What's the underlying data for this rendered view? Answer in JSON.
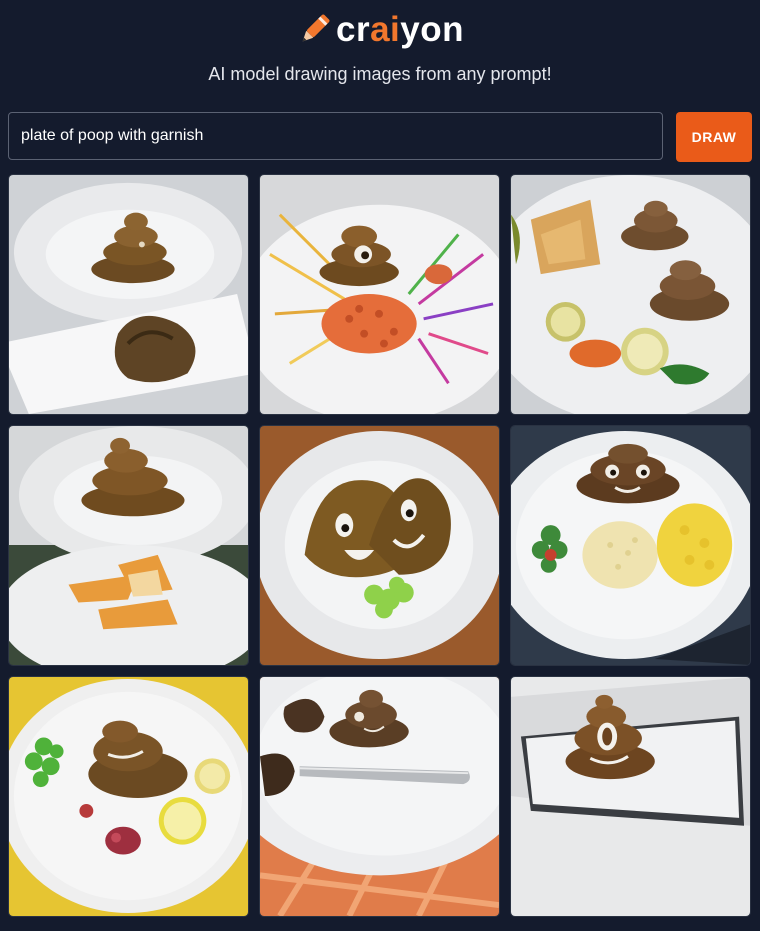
{
  "brand": {
    "logo_prefix": "cr",
    "logo_accent": "ai",
    "logo_suffix": "yon",
    "tagline": "AI model drawing images from any prompt!",
    "accent_color": "#f2772d"
  },
  "prompt": {
    "value": "plate of poop with garnish",
    "button_label": "DRAW",
    "button_color": "#ea5b19"
  },
  "results": {
    "count": 9,
    "images": [
      {
        "subject": "poop swirl on white plate with brown garnish"
      },
      {
        "subject": "poop with colorful sprigs and orange garnish"
      },
      {
        "subject": "two poop swirls with lemon slices and chips"
      },
      {
        "subject": "poop swirl on plate above fries"
      },
      {
        "subject": "smiling poop emoji with green garnish"
      },
      {
        "subject": "poop emoji with rice and yellow corn"
      },
      {
        "subject": "poop with lemon and herbs on yellow background"
      },
      {
        "subject": "poop on plate with knife and dark garnish"
      },
      {
        "subject": "poop emoji on white tray"
      }
    ]
  }
}
